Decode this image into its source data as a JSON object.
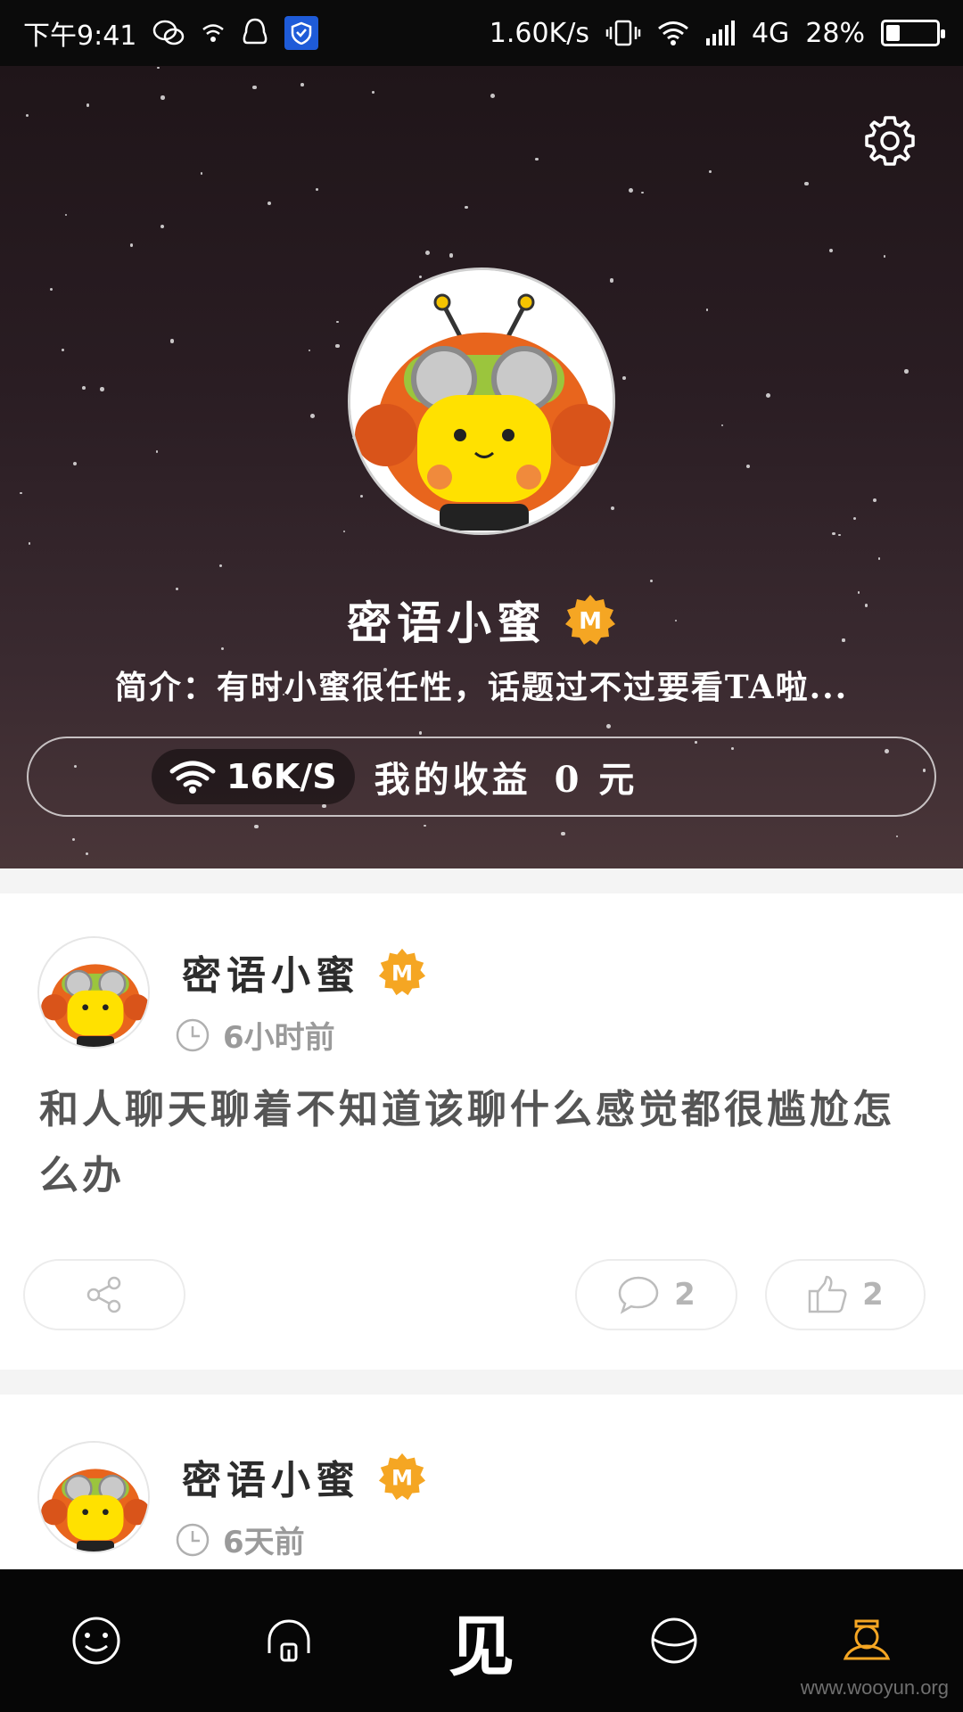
{
  "status_bar": {
    "time": "下午9:41",
    "net_speed": "1.60K/s",
    "network": "4G",
    "battery_percent": "28%",
    "battery_level": 0.28,
    "icons": [
      "chat-icon",
      "wifi-small-icon",
      "penguin-icon",
      "shield-icon",
      "vibrate-icon",
      "wifi-icon",
      "signal-icon",
      "battery-icon"
    ]
  },
  "profile": {
    "name": "密语小蜜",
    "badge_letter": "M",
    "bio": "简介：有时小蜜很任性，话题过不过要看TA啦...",
    "speed": "16K/S",
    "earnings_label": "我的收益",
    "earnings_amount": "0 元",
    "settings_icon": "gear-icon"
  },
  "posts": [
    {
      "author": "密语小蜜",
      "badge_letter": "M",
      "time": "6小时前",
      "content": "和人聊天聊着不知道该聊什么感觉都很尴尬怎么办",
      "comments": "2",
      "likes": "2"
    },
    {
      "author": "密语小蜜",
      "badge_letter": "M",
      "time": "6天前"
    }
  ],
  "bottom_nav": {
    "items": [
      "face-icon",
      "headphones-icon",
      "见",
      "planet-icon",
      "profile-icon"
    ],
    "center_label": "见",
    "active_color": "#f5a623"
  },
  "watermark": "www.wooyun.org",
  "colors": {
    "badge": "#f5a623",
    "status_bar": "#0b0b0b",
    "nav_bg": "#060606"
  }
}
